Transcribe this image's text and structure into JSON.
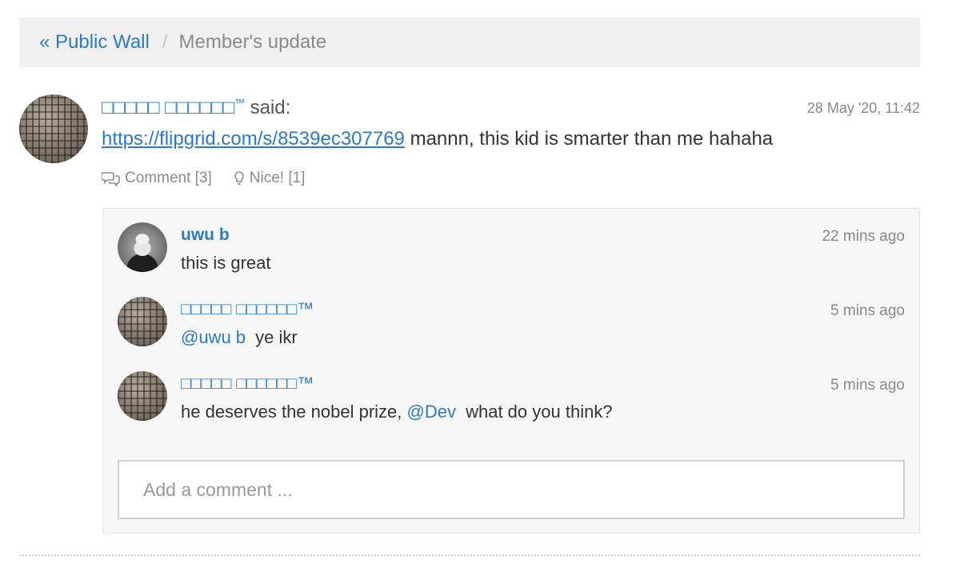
{
  "breadcrumb": {
    "back_label": "« Public Wall",
    "separator": "/",
    "current": "Member's update"
  },
  "post": {
    "author": "□□□□□ □□□□□□",
    "author_tm": "™",
    "said": "said:",
    "timestamp": "28 May '20, 11:42",
    "link": "https://flipgrid.com/s/8539ec307769",
    "text": " mannn, this kid is smarter than me hahaha",
    "comment_label": "Comment [3]",
    "nice_label": "Nice! [1]"
  },
  "comments": [
    {
      "author": "uwu b",
      "time": "22 mins ago",
      "text": "this is great"
    },
    {
      "author": "□□□□□ □□□□□□™",
      "time": "5 mins ago",
      "mention": "@uwu b",
      "text": " ye ikr"
    },
    {
      "author": "□□□□□ □□□□□□™",
      "time": "5 mins ago",
      "text_before": "he deserves the nobel prize, ",
      "mention": "@Dev",
      "text_after": " what do you think?"
    }
  ],
  "comment_input": {
    "placeholder": "Add a comment ..."
  },
  "icons": {
    "comment": "speech-bubbles-icon",
    "nice": "lightbulb-icon"
  },
  "colors": {
    "link": "#2a7ac9",
    "muted": "#888888",
    "panel": "#f7f7f7"
  }
}
